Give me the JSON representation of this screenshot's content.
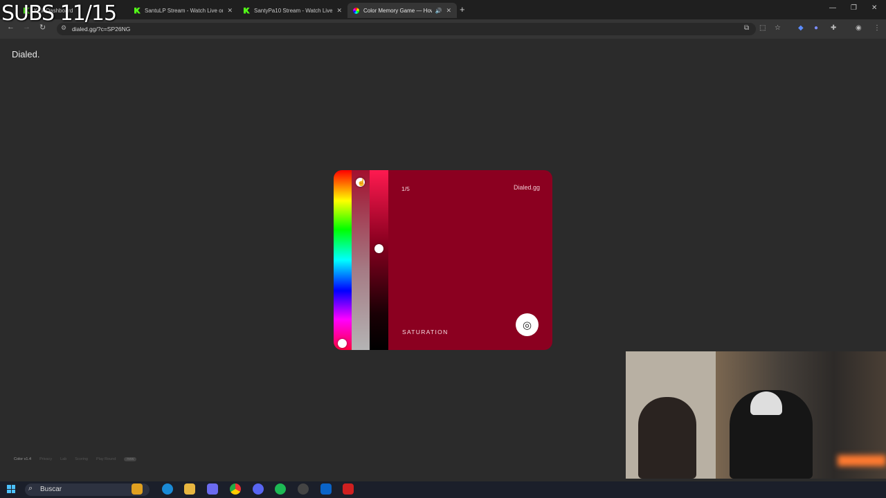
{
  "overlay": {
    "subs_text": "SUBS 11/15"
  },
  "browser": {
    "tabs": [
      {
        "title": "Kick Dashboard",
        "favicon": "kick-icon",
        "active": false
      },
      {
        "title": "SantuLP Stream - Watch Live on Kick",
        "favicon": "kick-icon",
        "active": false
      },
      {
        "title": "SantyPa10 Stream - Watch Live",
        "favicon": "kick-icon",
        "active": false
      },
      {
        "title": "Color Memory Game — How",
        "favicon": "color-wheel-icon",
        "active": true
      }
    ],
    "url": "dialed.gg/?c=SP26NG",
    "new_tab": "+",
    "window_controls": {
      "minimize": "—",
      "restore": "❐",
      "close": "✕"
    }
  },
  "page": {
    "logo": "Dialed.",
    "game": {
      "step": "1/5",
      "brand": "Dialed.gg",
      "mode_label": "SATURATION",
      "current_color": "#8b0020",
      "hue_level": 0.97,
      "saturation_level": 0.03,
      "lightness_level": 0.42
    },
    "footer": {
      "version": "Color v1.4",
      "links": [
        "Privacy",
        "Lab",
        "Scoring",
        "Play Round"
      ],
      "badge": "new"
    }
  },
  "taskbar": {
    "search_placeholder": "Buscar",
    "apps": [
      "pikachu-icon",
      "edge-icon",
      "files-icon",
      "copilot-icon",
      "chrome-icon",
      "discord-icon",
      "spotify-icon",
      "obs-icon",
      "outlook-icon",
      "app-icon"
    ]
  }
}
